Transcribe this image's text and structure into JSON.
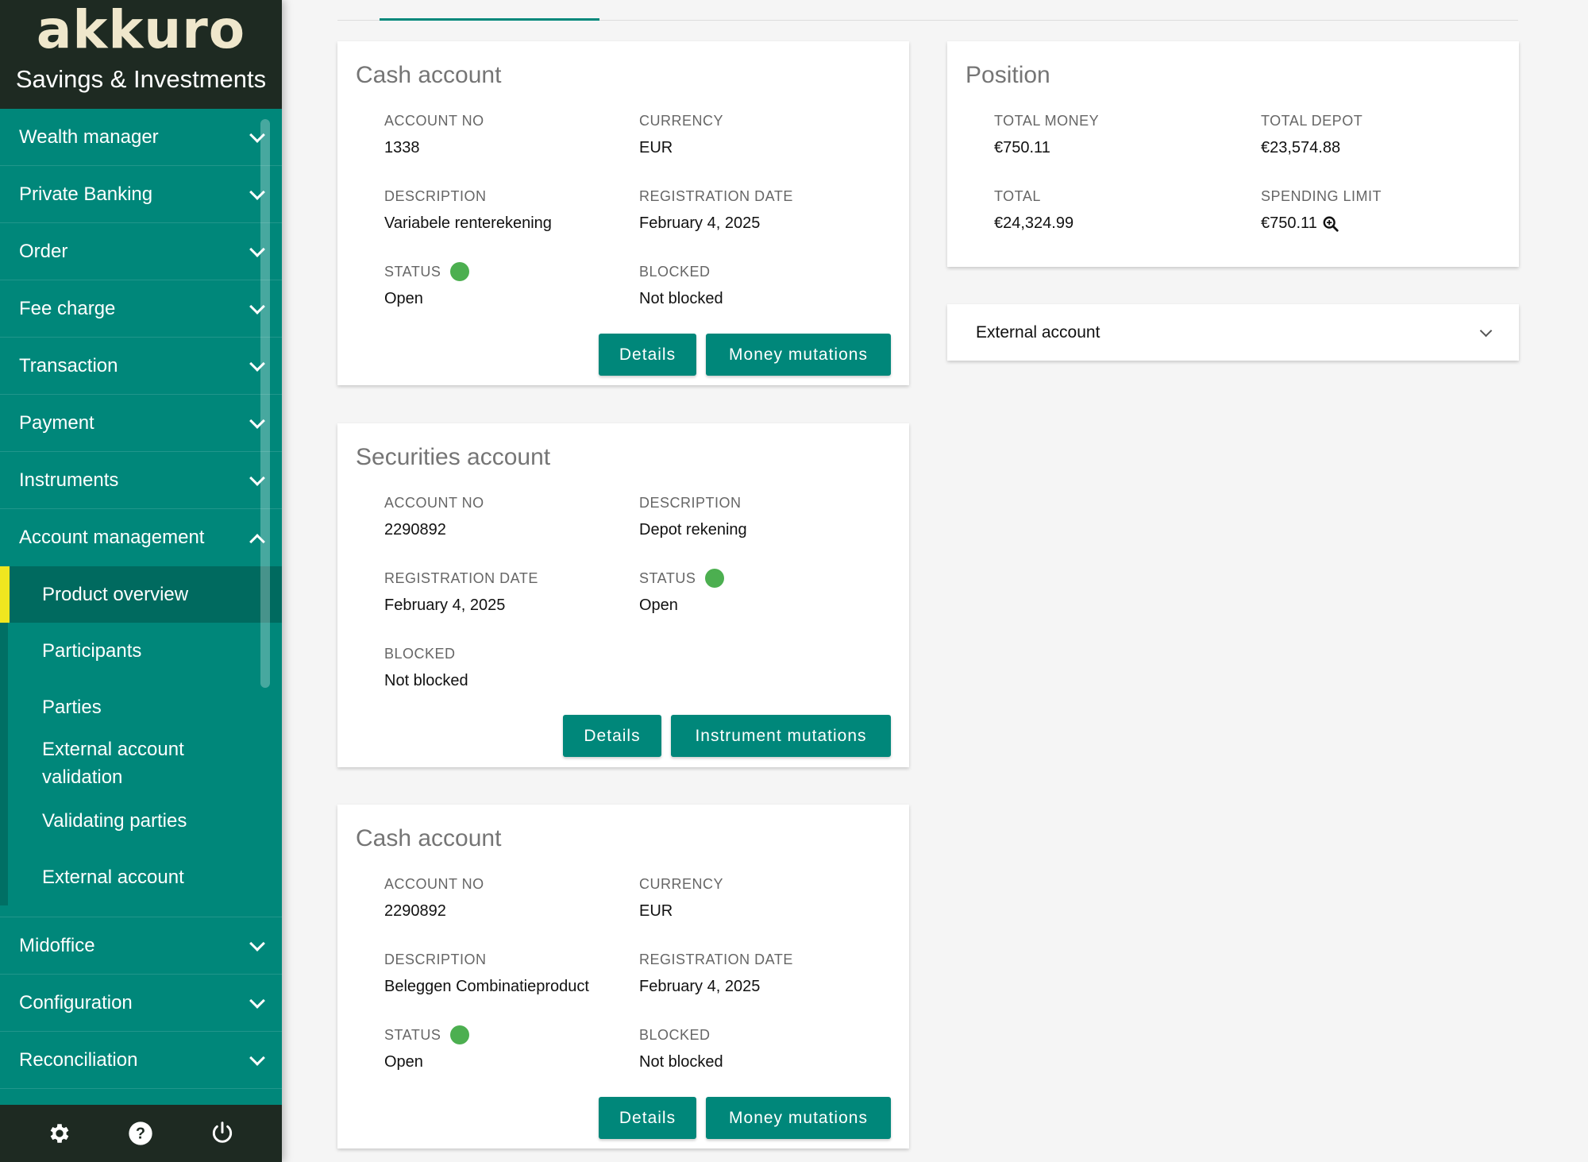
{
  "brand": {
    "logo": "akkuro",
    "subtitle": "Savings & Investments"
  },
  "sidebar": {
    "items": [
      {
        "label": "Wealth manager"
      },
      {
        "label": "Private Banking"
      },
      {
        "label": "Order"
      },
      {
        "label": "Fee charge"
      },
      {
        "label": "Transaction"
      },
      {
        "label": "Payment"
      },
      {
        "label": "Instruments"
      },
      {
        "label": "Account management"
      }
    ],
    "sub": [
      {
        "label": "Product overview"
      },
      {
        "label": "Participants"
      },
      {
        "label": "Parties"
      },
      {
        "label": "External account validation"
      },
      {
        "label": "Validating parties"
      },
      {
        "label": "External account"
      }
    ],
    "lower": [
      {
        "label": "Midoffice"
      },
      {
        "label": "Configuration"
      },
      {
        "label": "Reconciliation"
      }
    ]
  },
  "cash1": {
    "title": "Cash account",
    "account_no_label": "ACCOUNT NO",
    "account_no": "1338",
    "currency_label": "CURRENCY",
    "currency": "EUR",
    "description_label": "DESCRIPTION",
    "description": "Variabele renterekening",
    "reg_label": "REGISTRATION DATE",
    "reg": "February 4, 2025",
    "status_label": "STATUS",
    "status": "Open",
    "blocked_label": "BLOCKED",
    "blocked": "Not blocked",
    "details": "Details",
    "mutations": "Money mutations"
  },
  "securities": {
    "title": "Securities account",
    "account_no_label": "ACCOUNT NO",
    "account_no": "2290892",
    "description_label": "DESCRIPTION",
    "description": "Depot rekening",
    "reg_label": "REGISTRATION DATE",
    "reg": "February 4, 2025",
    "status_label": "STATUS",
    "status": "Open",
    "blocked_label": "BLOCKED",
    "blocked": "Not blocked",
    "details": "Details",
    "mutations": "Instrument mutations"
  },
  "cash2": {
    "title": "Cash account",
    "account_no_label": "ACCOUNT NO",
    "account_no": "2290892",
    "currency_label": "CURRENCY",
    "currency": "EUR",
    "description_label": "DESCRIPTION",
    "description": "Beleggen Combinatieproduct",
    "reg_label": "REGISTRATION DATE",
    "reg": "February 4, 2025",
    "status_label": "STATUS",
    "status": "Open",
    "blocked_label": "BLOCKED",
    "blocked": "Not blocked",
    "details": "Details",
    "mutations": "Money mutations"
  },
  "position": {
    "title": "Position",
    "total_money_label": "TOTAL MONEY",
    "total_money": "€750.11",
    "total_depot_label": "TOTAL DEPOT",
    "total_depot": "€23,574.88",
    "total_label": "TOTAL",
    "total": "€24,324.99",
    "spending_label": "SPENDING LIMIT",
    "spending": "€750.11"
  },
  "external": {
    "label": "External account"
  },
  "colors": {
    "primary": "#00877a",
    "dark": "#1e2a22",
    "status_open": "#4caf50",
    "active_marker": "#f0e61f"
  },
  "icons": {
    "footer": [
      "gear-icon",
      "help-icon",
      "power-icon"
    ],
    "spending": "zoom-in-icon"
  }
}
